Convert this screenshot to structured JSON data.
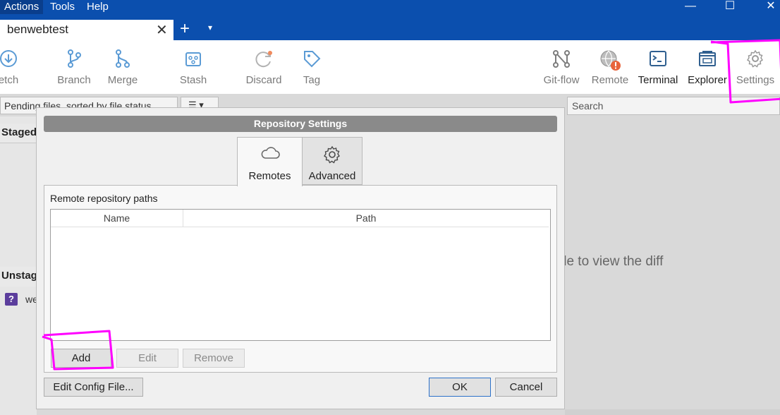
{
  "menu": {
    "items": [
      {
        "label": "Actions"
      },
      {
        "label": "Tools"
      },
      {
        "label": "Help"
      }
    ]
  },
  "window_controls": {
    "minimize": "—",
    "maximize": "☐",
    "close": "✕"
  },
  "tab": {
    "title": "benwebtest",
    "close": "✕",
    "new": "+",
    "dropdown": "▾"
  },
  "toolbar": {
    "fetch": "etch",
    "branch": "Branch",
    "merge": "Merge",
    "stash": "Stash",
    "discard": "Discard",
    "tag": "Tag",
    "gitflow": "Git-flow",
    "remote": "Remote",
    "terminal": "Terminal",
    "explorer": "Explorer",
    "settings": "Settings"
  },
  "main": {
    "pending_sort": "Pending files, sorted by file status",
    "view_menu": "☰ ▾",
    "staged_header": "Staged",
    "unstaged_header": "Unstaged",
    "file_name": "we",
    "file_icon": "?",
    "search_placeholder": "Search",
    "diff_hint": "ile to view the diff"
  },
  "dialog": {
    "title": "Repository Settings",
    "tabs": [
      {
        "label": "Remotes",
        "icon": "cloud-icon"
      },
      {
        "label": "Advanced",
        "icon": "gear-icon"
      }
    ],
    "section_label": "Remote repository paths",
    "columns": [
      "Name",
      "Path"
    ],
    "rows": [],
    "buttons": {
      "add": "Add",
      "edit": "Edit",
      "remove": "Remove",
      "edit_config": "Edit Config File...",
      "ok": "OK",
      "cancel": "Cancel"
    }
  },
  "annotations": {
    "color": "#ff00ff"
  }
}
